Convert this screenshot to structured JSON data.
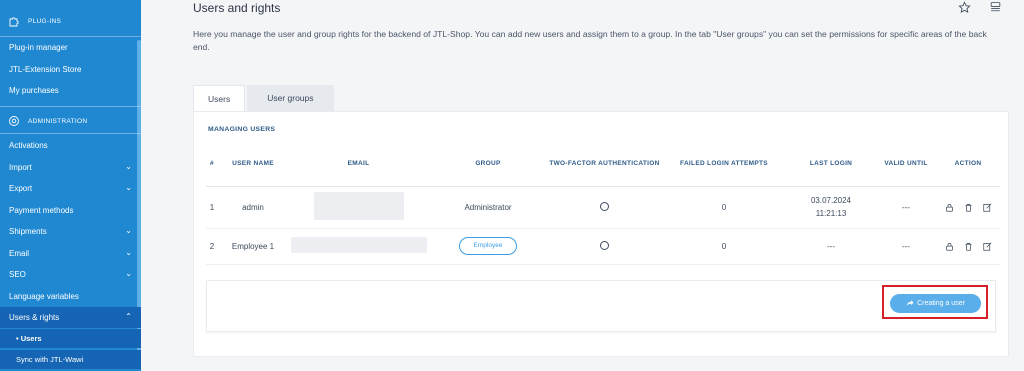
{
  "sidebar": {
    "plugins_section": "PLUG-INS",
    "plugins_items": [
      "Plug-in manager",
      "JTL-Extension Store",
      "My purchases"
    ],
    "admin_section": "ADMINISTRATION",
    "admin_items": [
      {
        "label": "Activations",
        "chevron": ""
      },
      {
        "label": "Import",
        "chevron": "⌄"
      },
      {
        "label": "Export",
        "chevron": "⌄"
      },
      {
        "label": "Payment methods",
        "chevron": ""
      },
      {
        "label": "Shipments",
        "chevron": "⌄"
      },
      {
        "label": "Email",
        "chevron": "⌄"
      },
      {
        "label": "SEO",
        "chevron": "⌄"
      },
      {
        "label": "Language variables",
        "chevron": ""
      },
      {
        "label": "Users & rights",
        "chevron": "⌃"
      }
    ],
    "sub_items": [
      "• Users",
      "Sync with JTL-Wawi"
    ],
    "icons": {
      "plugins": "puzzle-icon",
      "admin": "gear-icon"
    }
  },
  "page": {
    "title": "Users and rights",
    "description": "Here you manage the user and group rights for the backend of JTL-Shop. You can add new users and assign them to a group. In the tab \"User groups\" you can set the permissions for specific areas of the back end.",
    "top_icons": [
      "star-icon",
      "menu-icon"
    ]
  },
  "tabs": [
    {
      "label": "Users",
      "active": true
    },
    {
      "label": "User groups",
      "active": false
    }
  ],
  "panel": {
    "title": "MANAGING USERS",
    "columns": [
      "#",
      "USER NAME",
      "EMAIL",
      "GROUP",
      "TWO-FACTOR AUTHENTICATION",
      "FAILED LOGIN ATTEMPTS",
      "LAST LOGIN",
      "VALID UNTIL",
      "ACTION"
    ],
    "rows": [
      {
        "num": "1",
        "username": "admin",
        "email": "",
        "group": "Administrator",
        "group_is_button": false,
        "failed": "0",
        "last_login": "03.07.2024 11:21:13",
        "valid_until": "---"
      },
      {
        "num": "2",
        "username": "Employee 1",
        "email": "",
        "group": "Employee",
        "group_is_button": true,
        "failed": "0",
        "last_login": "---",
        "valid_until": "---"
      }
    ],
    "action_icons": [
      "lock-icon",
      "trash-icon",
      "edit-icon"
    ],
    "create_button": "Creating a user"
  },
  "colors": {
    "sidebar_bg": "#1f88d1",
    "sidebar_active": "#1565b4",
    "accent": "#3b9ee6",
    "highlight": "#d61f26"
  }
}
